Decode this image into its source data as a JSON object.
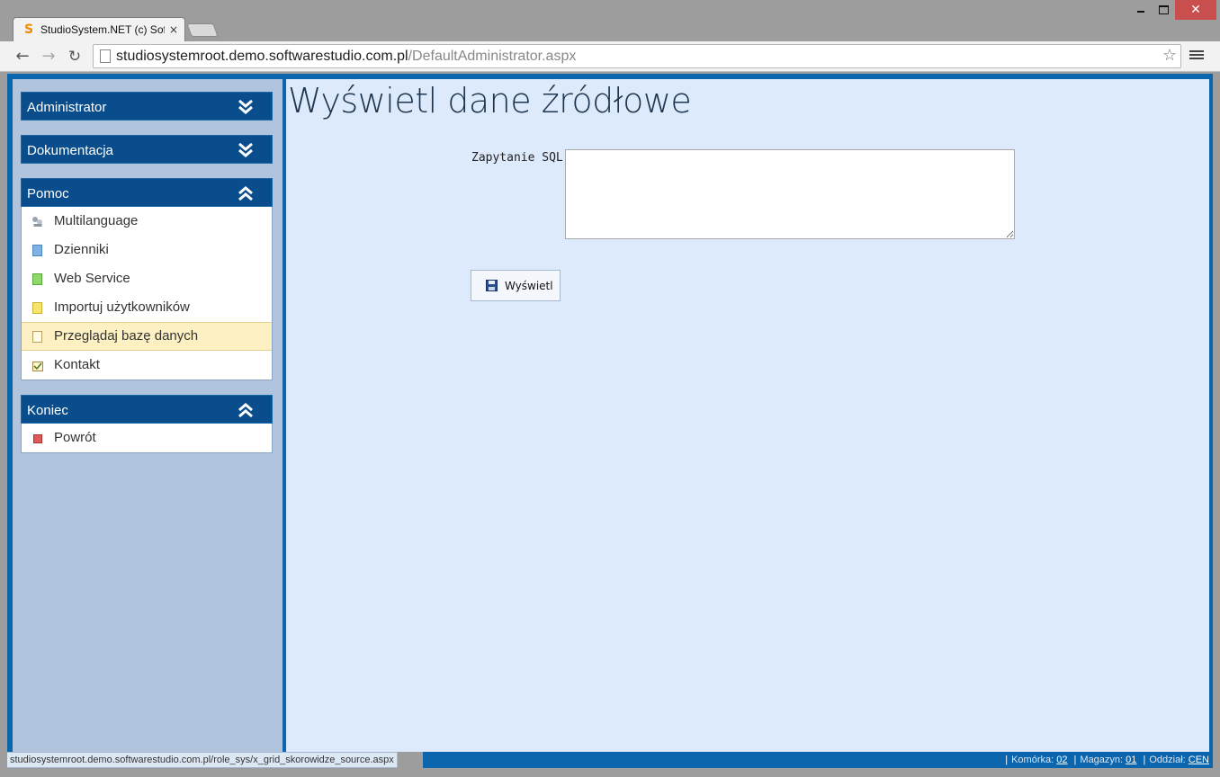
{
  "browser": {
    "tab_title": "StudioSystem.NET (c) Soft",
    "tab_close": "×",
    "url_host": "studiosystemroot.demo.softwarestudio.com.pl",
    "url_path": "/DefaultAdministrator.aspx",
    "favicon": "S",
    "close_symbol": "✕",
    "star_symbol": "☆",
    "back_symbol": "←",
    "forward_symbol": "→",
    "reload_symbol": "↻"
  },
  "sidebar": {
    "panels": [
      {
        "title": "Administrator",
        "expanded": false
      },
      {
        "title": "Dokumentacja",
        "expanded": false
      },
      {
        "title": "Pomoc",
        "expanded": true,
        "items": [
          {
            "label": "Multilanguage",
            "icon": "people-icon"
          },
          {
            "label": "Dzienniki",
            "icon": "document-blue-icon"
          },
          {
            "label": "Web Service",
            "icon": "document-green-icon"
          },
          {
            "label": "Importuj użytkowników",
            "icon": "document-yellow-icon"
          },
          {
            "label": "Przeglądaj bazę danych",
            "icon": "document-edit-icon",
            "selected": true
          },
          {
            "label": "Kontakt",
            "icon": "contact-icon"
          }
        ]
      },
      {
        "title": "Koniec",
        "expanded": true,
        "items": [
          {
            "label": "Powrót",
            "icon": "stop-icon"
          }
        ]
      }
    ]
  },
  "main": {
    "title": "Wyświetl dane źródłowe",
    "sql_label": "Zapytanie SQL",
    "sql_value": "",
    "show_button": "Wyświetl"
  },
  "status": {
    "hover_url": "studiosystemroot.demo.softwarestudio.com.pl/role_sys/x_grid_skorowidze_source.aspx",
    "komorka_label": "Komórka:",
    "komorka_value": "02",
    "magazyn_label": "Magazyn:",
    "magazyn_value": "01",
    "oddzial_label": "Oddział:",
    "oddzial_value": "CEN"
  },
  "colors": {
    "accent": "#0b66ad",
    "panel_header": "#0a4d8c",
    "sidebar_bg": "#b0c4de",
    "main_bg": "#ddeafb",
    "selected_item": "#fdf0c2"
  }
}
